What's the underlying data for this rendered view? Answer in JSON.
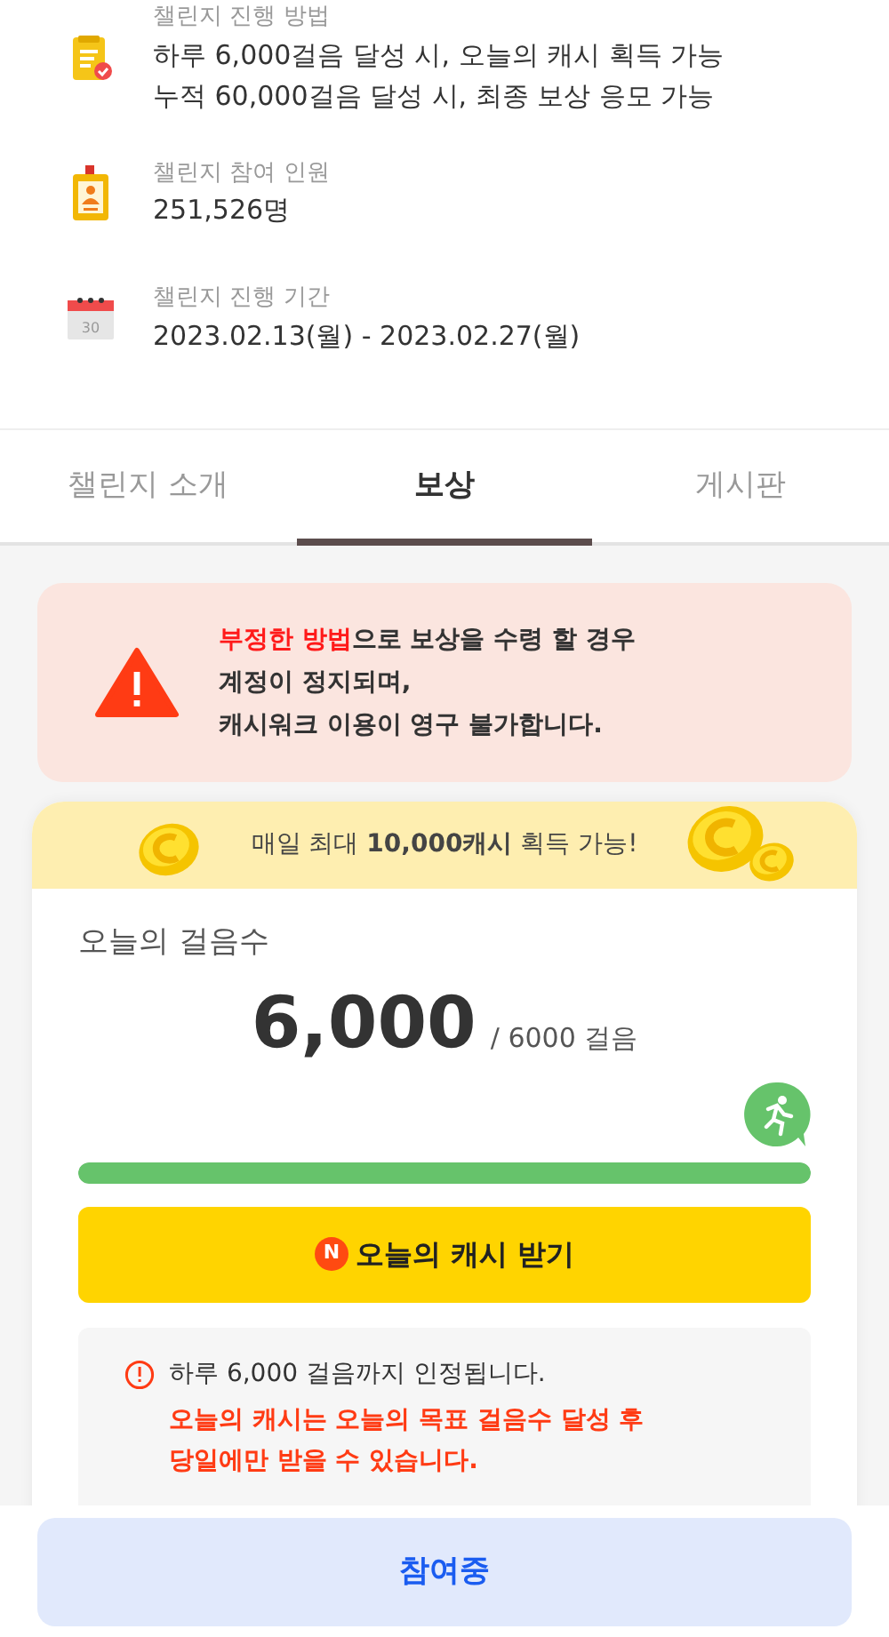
{
  "info_items": [
    {
      "kind": "method",
      "label": "챌린지 진행 방법",
      "lines": [
        "하루 6,000걸음 달성 시, 오늘의 캐시 획득 가능",
        "누적 60,000걸음 달성 시, 최종 보상 응모 가능"
      ]
    },
    {
      "kind": "participants",
      "label": "챌린지 참여 인원",
      "lines": [
        "251,526명"
      ]
    },
    {
      "kind": "period",
      "label": "챌린지 진행 기간",
      "icon_label": "30",
      "lines": [
        "2023.02.13(월) - 2023.02.27(월)"
      ]
    }
  ],
  "tabs": [
    {
      "label": "챌린지 소개",
      "selected": false
    },
    {
      "label": "보상",
      "selected": true
    },
    {
      "label": "게시판",
      "selected": false
    }
  ],
  "warning": {
    "lines": [
      "**부정한 방법**으로 보상을 수령 할 경우",
      "계정이 정지되며,",
      "캐시워크 이용이 영구 불가합니다."
    ]
  },
  "reward_card": {
    "banner": "매일 최대 **10,000캐시** 획득 가능!",
    "steps_label": "오늘의 걸음수",
    "steps_count": "6,000",
    "steps_goal": "/ 6000 걸음",
    "progress": {
      "level": 1.0
    },
    "claim_button": {
      "badge": "N",
      "label": "오늘의 캐시 받기"
    },
    "notice": {
      "text": "하루 6,000 걸음까지 인정됩니다.",
      "highlight_lines": [
        "오늘의 캐시는 오늘의 목표 걸음수 달성 후",
        "당일에만 받을 수 있습니다."
      ]
    }
  },
  "bottom_button": "참여중"
}
